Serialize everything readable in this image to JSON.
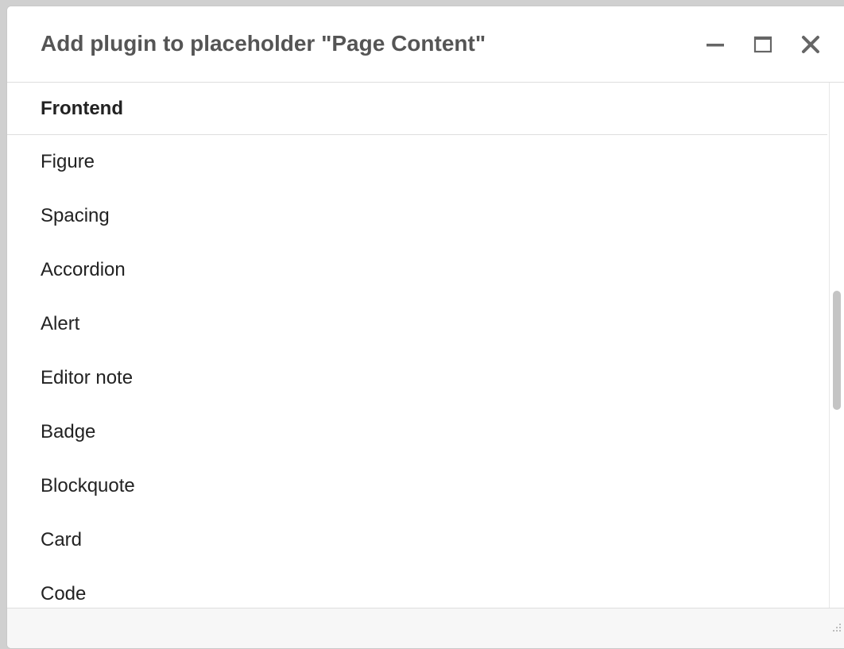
{
  "dialog": {
    "title": "Add plugin to placeholder \"Page Content\"",
    "controls": {
      "minimize_icon": "minimize-icon",
      "maximize_icon": "maximize-icon",
      "close_icon": "close-icon"
    }
  },
  "plugin_group": {
    "name": "Frontend",
    "items": [
      {
        "label": "Figure"
      },
      {
        "label": "Spacing"
      },
      {
        "label": "Accordion"
      },
      {
        "label": "Alert"
      },
      {
        "label": "Editor note"
      },
      {
        "label": "Badge"
      },
      {
        "label": "Blockquote"
      },
      {
        "label": "Card"
      },
      {
        "label": "Code"
      }
    ]
  },
  "colors": {
    "title_text": "#555555",
    "item_text": "#222222",
    "divider": "#dedede",
    "scroll_thumb": "#c4c4c4"
  }
}
